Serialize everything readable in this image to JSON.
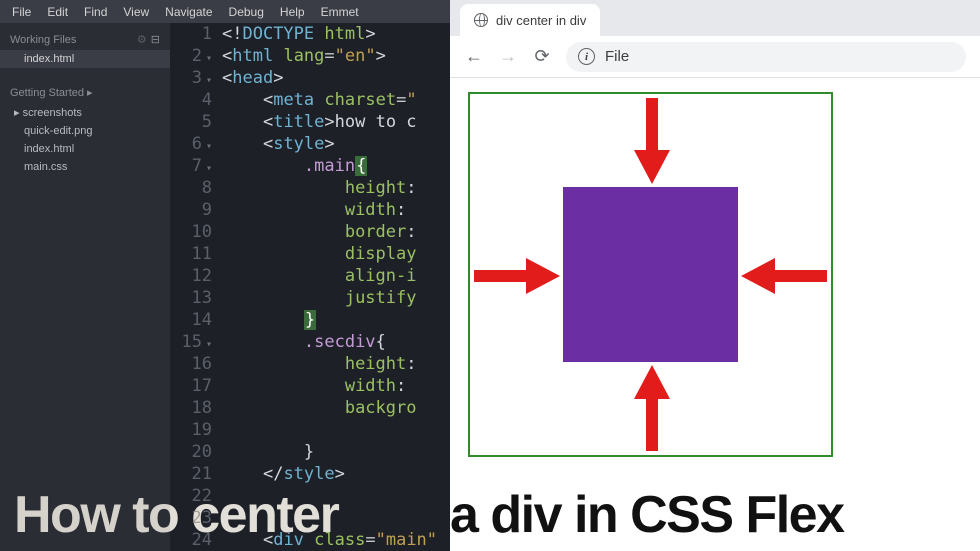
{
  "menu": [
    "File",
    "Edit",
    "Find",
    "View",
    "Navigate",
    "Debug",
    "Help",
    "Emmet"
  ],
  "sidebar": {
    "working_title": "Working Files",
    "working_files": [
      "index.html"
    ],
    "getting_started": "Getting Started",
    "folder": "screenshots",
    "files": [
      "quick-edit.png",
      "index.html",
      "main.css"
    ]
  },
  "code": {
    "lines": [
      {
        "n": 1,
        "html": "<span class='punct'>&lt;!</span><span class='tag'>DOCTYPE</span> <span class='attr'>html</span><span class='punct'>&gt;</span>"
      },
      {
        "n": 2,
        "fold": true,
        "html": "<span class='punct'>&lt;</span><span class='tag'>html</span> <span class='attr'>lang</span>=<span class='val'>\"en\"</span><span class='punct'>&gt;</span>"
      },
      {
        "n": 3,
        "fold": true,
        "html": "<span class='punct'>&lt;</span><span class='tag'>head</span><span class='punct'>&gt;</span>"
      },
      {
        "n": 4,
        "html": "    <span class='punct'>&lt;</span><span class='tag'>meta</span> <span class='attr'>charset</span>=<span class='val'>\"</span>"
      },
      {
        "n": 5,
        "html": "    <span class='punct'>&lt;</span><span class='tag'>title</span><span class='punct'>&gt;</span><span class='txt'>how to c</span>"
      },
      {
        "n": 6,
        "fold": true,
        "html": "    <span class='punct'>&lt;</span><span class='tag'>style</span><span class='punct'>&gt;</span>"
      },
      {
        "n": 7,
        "fold": true,
        "html": "        <span class='sel'>.main</span><span class='bracket-hl'>{</span>"
      },
      {
        "n": 8,
        "html": "            <span class='prop'>height</span><span class='punct'>:</span>"
      },
      {
        "n": 9,
        "html": "            <span class='prop'>width</span><span class='punct'>:</span>"
      },
      {
        "n": 10,
        "html": "            <span class='prop'>border</span><span class='punct'>:</span>"
      },
      {
        "n": 11,
        "html": "            <span class='prop'>display</span>"
      },
      {
        "n": 12,
        "html": "            <span class='prop'>align-i</span>"
      },
      {
        "n": 13,
        "html": "            <span class='prop'>justify</span>"
      },
      {
        "n": 14,
        "html": "        <span class='bracket-hl'>}</span>"
      },
      {
        "n": 15,
        "fold": true,
        "html": "        <span class='sel'>.secdiv</span><span class='punct'>{</span>"
      },
      {
        "n": 16,
        "html": "            <span class='prop'>height</span><span class='punct'>:</span>"
      },
      {
        "n": 17,
        "html": "            <span class='prop'>width</span><span class='punct'>:</span>"
      },
      {
        "n": 18,
        "html": "            <span class='prop'>backgro</span>"
      },
      {
        "n": 19,
        "html": ""
      },
      {
        "n": 20,
        "html": "        <span class='punct'>}</span>"
      },
      {
        "n": 21,
        "html": "    <span class='punct'>&lt;/</span><span class='tag'>style</span><span class='punct'>&gt;</span>"
      },
      {
        "n": 22,
        "html": ""
      },
      {
        "n": 23,
        "html": ""
      },
      {
        "n": 24,
        "html": "    <span class='punct'>&lt;</span><span class='tag'>div</span> <span class='attr'>class</span>=<span class='val'>\"main\"</span>"
      }
    ]
  },
  "browser": {
    "tab_title": "div center in div",
    "omnibox": "File"
  },
  "caption_left": "How to center",
  "caption_right": " a div in CSS Flex"
}
